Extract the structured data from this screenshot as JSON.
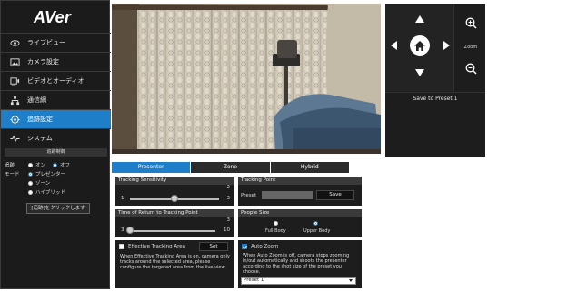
{
  "brand": {
    "logo": "AVer"
  },
  "sidebar": {
    "items": [
      {
        "label": "ライブビュー",
        "icon": "eye-icon"
      },
      {
        "label": "カメラ設定",
        "icon": "image-icon"
      },
      {
        "label": "ビデオとオーディオ",
        "icon": "video-audio-icon"
      },
      {
        "label": "通信網",
        "icon": "network-icon"
      },
      {
        "label": "追跡設定",
        "icon": "target-icon",
        "active": true
      },
      {
        "label": "システム",
        "icon": "pulse-icon"
      }
    ]
  },
  "tracking_panel": {
    "header": "追跡制御",
    "tracking_label": "追跡",
    "on_label": "オン",
    "off_label": "オフ",
    "mode_label": "モード",
    "presenter_label": "プレゼンター",
    "zone_label": "ゾーン",
    "hybrid_label": "ハイブリッド",
    "click_button": "[追跡]をクリックします"
  },
  "ptz": {
    "zoom_label": "Zoom",
    "save_to_preset": "Save to Preset 1"
  },
  "tabs": [
    {
      "label": "Presenter",
      "active": true
    },
    {
      "label": "Zone"
    },
    {
      "label": "Hybrid"
    }
  ],
  "presenter": {
    "tracking_sensitivity": {
      "title": "Tracking Sensitivity",
      "value": "2",
      "min": "1",
      "max": "3",
      "level": 0.5
    },
    "return_time": {
      "title": "Time of Return to Tracking Point",
      "value": "3",
      "min": "3",
      "max": "10",
      "level": 0.0
    },
    "effective_area": {
      "label": "Effective Tracking Area",
      "checked": false,
      "set_button": "Set",
      "description": "When Effective Tracking Area is on, camera only tracks around the selected area, please configure the targeted area from the live view."
    },
    "tracking_point": {
      "title": "Tracking Point",
      "preset_label": "Preset",
      "preset_value": "",
      "save_button": "Save"
    },
    "people_size": {
      "title": "People Size",
      "full_body": "Full Body",
      "upper_body": "Upper Body",
      "selected": "upper_body"
    },
    "auto_zoom": {
      "label": "Auto Zoom",
      "checked": true,
      "description": "When Auto Zoom is off, camera stops zooming in/out automatically and shoots the presenter according to the shot size of the preset you choose.",
      "preset_select": "Preset 1"
    }
  },
  "colors": {
    "accent": "#1e7fc8",
    "sidebar_bg": "#1b1b1b",
    "panel_bg": "#1d1d1d"
  }
}
